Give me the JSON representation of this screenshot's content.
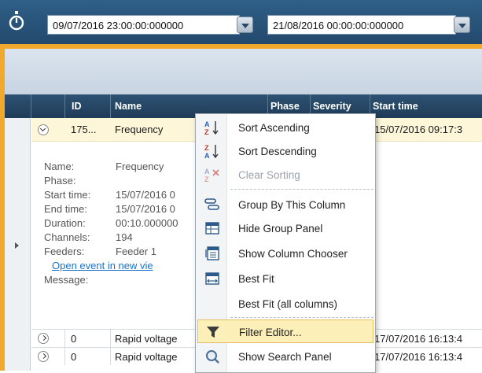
{
  "toolbar": {
    "start_date": "09/07/2016 23:00:00:000000",
    "end_date": "21/08/2016 00:00:00:000000"
  },
  "grid": {
    "columns": [
      "ID",
      "Name",
      "Phase",
      "Severity",
      "Start time"
    ],
    "expanded_row": {
      "id": "175...",
      "name": "Frequency",
      "start_time": "15/07/2016 09:17:3"
    },
    "details": {
      "labels": [
        "Name:",
        "Phase:",
        "Start time:",
        "End time:",
        "Duration:",
        "Channels:",
        "Feeders:"
      ],
      "values": [
        "Frequency",
        "",
        "15/07/2016 0",
        "15/07/2016 0",
        "00:10.000000",
        "194",
        "Feeder 1"
      ],
      "link": "Open event in new vie",
      "message_label": "Message:"
    },
    "rows": [
      {
        "id": "0",
        "name": "Rapid voltage",
        "start_time": "17/07/2016 16:13:4"
      },
      {
        "id": "0",
        "name": "Rapid voltage",
        "start_time": "17/07/2016 16:13:4"
      }
    ]
  },
  "context_menu": {
    "items": [
      {
        "label": "Sort Ascending",
        "icon": "sort-ascending-icon"
      },
      {
        "label": "Sort Descending",
        "icon": "sort-descending-icon"
      },
      {
        "label": "Clear Sorting",
        "icon": "clear-sorting-icon",
        "disabled": true
      },
      {
        "label": "Group By This Column",
        "icon": "group-by-icon"
      },
      {
        "label": "Hide Group Panel",
        "icon": "group-panel-icon"
      },
      {
        "label": "Show Column Chooser",
        "icon": "column-chooser-icon"
      },
      {
        "label": "Best Fit",
        "icon": "best-fit-icon"
      },
      {
        "label": "Best Fit (all columns)",
        "icon": ""
      },
      {
        "label": "Filter Editor...",
        "icon": "filter-icon",
        "highlighted": true
      },
      {
        "label": "Show Search Panel",
        "icon": "search-icon"
      }
    ]
  },
  "colors": {
    "header_bg": "#2d5273",
    "accent_orange": "#f0a92c",
    "highlight": "#fcefb8",
    "link": "#1a73c9"
  }
}
